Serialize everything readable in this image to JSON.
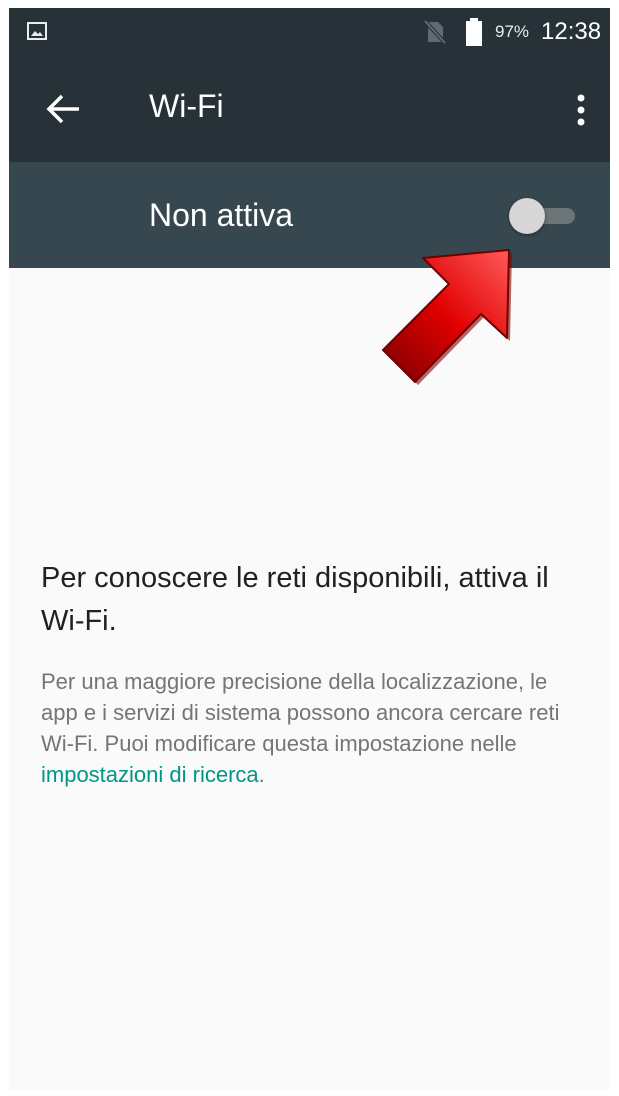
{
  "status_bar": {
    "battery": "97%",
    "time": "12:38",
    "icons": [
      "image-notification-icon",
      "no-sim-icon",
      "battery-icon"
    ]
  },
  "app_bar": {
    "title": "Wi-Fi",
    "icons": [
      "back-arrow-icon",
      "more-vert-icon"
    ]
  },
  "switch_bar": {
    "label": "Non attiva",
    "enabled": false
  },
  "empty_state": {
    "heading": "Per conoscere le reti disponibili, attiva il Wi-Fi.",
    "body_text": "Per una maggiore precisione della localizzazione, le app e i servizi di sistema possono ancora cercare reti Wi-Fi. Puoi modificare questa impostazione nelle ",
    "link_text": "impostazioni di ricerca",
    "trailing": "."
  },
  "colors": {
    "app_bar_bg": "#263238",
    "switch_bar_bg": "#37474f",
    "link": "#009688",
    "annotation_arrow": "#d50000"
  },
  "annotation": {
    "type": "arrow",
    "points_to": "wifi-toggle-switch"
  }
}
